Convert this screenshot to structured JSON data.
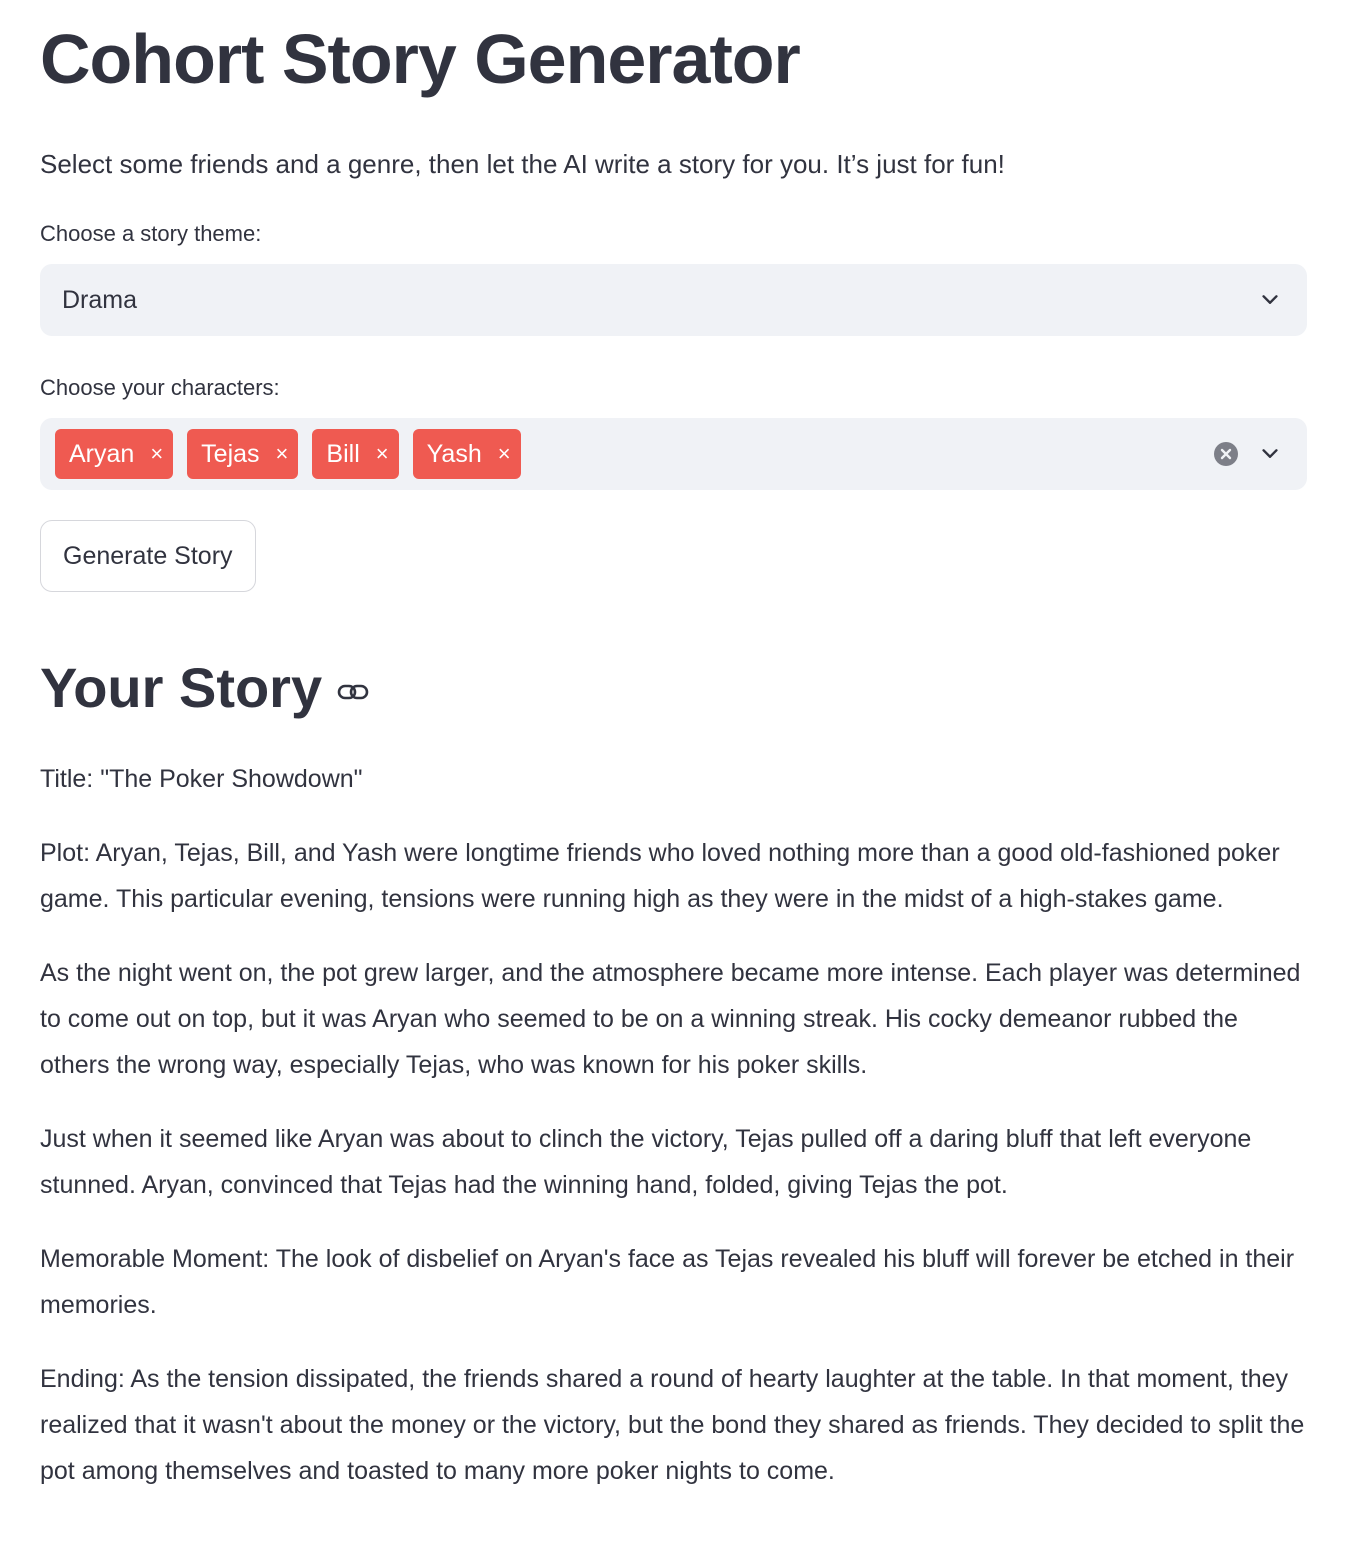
{
  "header": {
    "title": "Cohort Story Generator",
    "subtitle": "Select some friends and a genre, then let the AI write a story for you. It’s just for fun!"
  },
  "theme_select": {
    "label": "Choose a story theme:",
    "value": "Drama",
    "icon": "chevron-down-icon"
  },
  "characters_select": {
    "label": "Choose your characters:",
    "chips": [
      {
        "label": "Aryan",
        "remove": "×"
      },
      {
        "label": "Tejas",
        "remove": "×"
      },
      {
        "label": "Bill",
        "remove": "×"
      },
      {
        "label": "Yash",
        "remove": "×"
      }
    ],
    "chip_color": "#ef5a51",
    "icons": [
      "clear-all-icon",
      "chevron-down-icon"
    ]
  },
  "generate_button": {
    "label": "Generate Story"
  },
  "story_section": {
    "heading": "Your Story",
    "heading_icon": "link-icon",
    "paragraphs": [
      "Title: \"The Poker Showdown\"",
      "Plot: Aryan, Tejas, Bill, and Yash were longtime friends who loved nothing more than a good old-fashioned poker game. This particular evening, tensions were running high as they were in the midst of a high-stakes game.",
      "As the night went on, the pot grew larger, and the atmosphere became more intense. Each player was determined to come out on top, but it was Aryan who seemed to be on a winning streak. His cocky demeanor rubbed the others the wrong way, especially Tejas, who was known for his poker skills.",
      "Just when it seemed like Aryan was about to clinch the victory, Tejas pulled off a daring bluff that left everyone stunned. Aryan, convinced that Tejas had the winning hand, folded, giving Tejas the pot.",
      "Memorable Moment: The look of disbelief on Aryan's face as Tejas revealed his bluff will forever be etched in their memories.",
      "Ending: As the tension dissipated, the friends shared a round of hearty laughter at the table. In that moment, they realized that it wasn't about the money or the victory, but the bond they shared as friends. They decided to split the pot among themselves and toasted to many more poker nights to come."
    ]
  },
  "colors": {
    "text": "#31333f",
    "input_bg": "#f0f2f6",
    "accent": "#ef5a51"
  }
}
